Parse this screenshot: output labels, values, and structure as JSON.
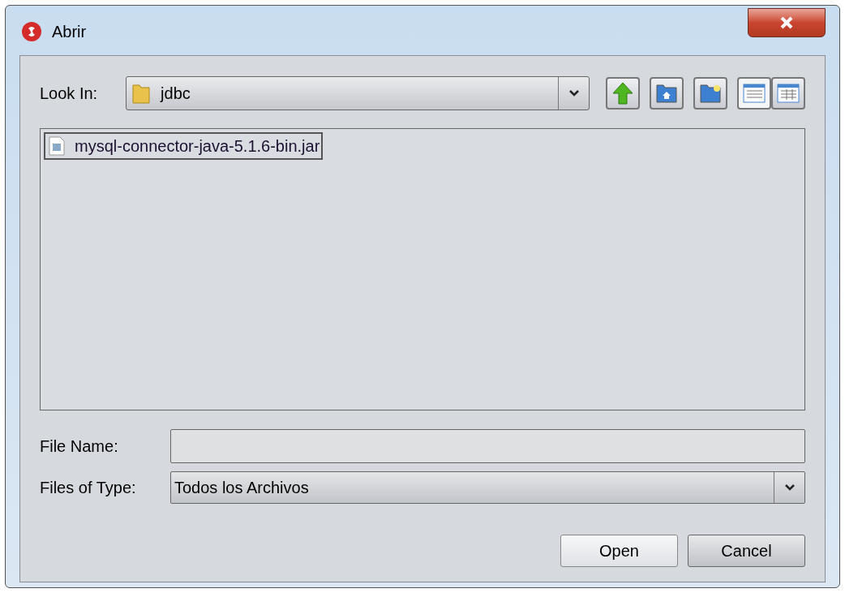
{
  "window": {
    "title": "Abrir"
  },
  "look_in": {
    "label": "Look In:",
    "value": "jdbc"
  },
  "files": [
    {
      "name": "mysql-connector-java-5.1.6-bin.jar",
      "selected": true
    }
  ],
  "file_name": {
    "label": "File Name:"
  },
  "files_of_type": {
    "label": "Files of Type:",
    "value": "Todos los Archivos"
  },
  "buttons": [
    {
      "label": "Open",
      "kind": "default"
    },
    {
      "label": "Cancel",
      "kind": "normal"
    }
  ]
}
